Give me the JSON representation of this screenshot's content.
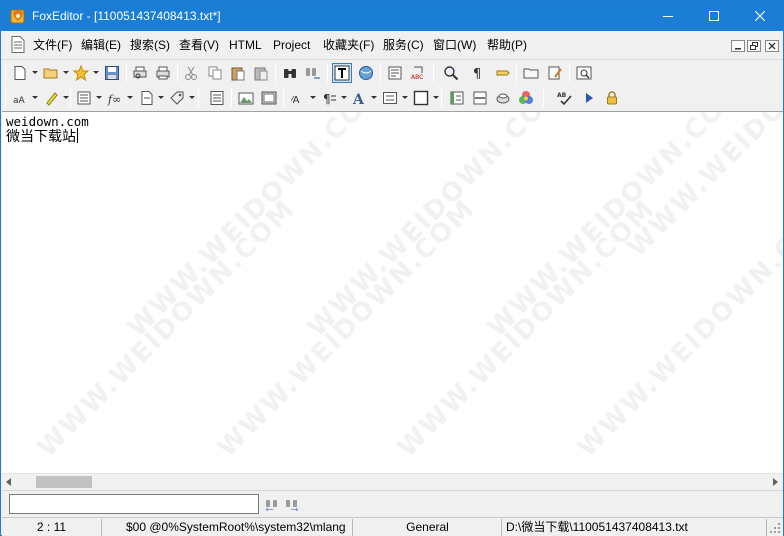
{
  "window": {
    "title": "FoxEditor - [110051437408413.txt*]"
  },
  "menu": {
    "items": [
      "文件(F)",
      "编辑(E)",
      "搜索(S)",
      "查看(V)",
      "HTML",
      "Project",
      "收藏夹(F)",
      "服务(C)",
      "窗口(W)",
      "帮助(P)"
    ]
  },
  "editor": {
    "lines": [
      "weidown.com",
      "微当下载站"
    ],
    "watermark": "WWW.WEIDOWN.COM"
  },
  "findbar": {
    "value": ""
  },
  "status": {
    "position": "2 : 11",
    "char_info": "$00 @0%SystemRoot%\\system32\\mlang",
    "mode": "General",
    "path": "D:\\微当下载\\110051437408413.txt"
  },
  "colors": {
    "titlebar": "#1a7fd4",
    "toolbar_bg": "#f0f0f0",
    "editor_bg": "#ffffff"
  },
  "icons": {
    "toolbar1": [
      "new-file-icon",
      "open-folder-icon",
      "favorites-star-icon",
      "save-icon",
      "print-preview-icon",
      "print-icon",
      "cut-icon",
      "copy-icon",
      "paste-icon",
      "paste-special-icon",
      "find-icon",
      "find-next-icon",
      "text-mode-icon",
      "web-preview-icon",
      "document-props-icon",
      "spellcheck-icon",
      "zoom-icon",
      "paragraph-marks-icon",
      "bookmark-icon",
      "folder-icon",
      "edit-doc-icon",
      "screen-capture-icon"
    ],
    "toolbar2": [
      "font-size-icon",
      "highlighter-icon",
      "list-icon",
      "function-icon",
      "template-icon",
      "tags-icon",
      "page-icon",
      "image-icon",
      "image-frame-icon",
      "text-case-icon",
      "paragraph-style-icon",
      "text-color-icon",
      "list-format-icon",
      "table-icon",
      "insert-block-icon",
      "horizontal-rule-icon",
      "comment-icon",
      "color-picker-icon",
      "spellcheck-abc-icon",
      "run-icon",
      "lock-icon"
    ]
  }
}
